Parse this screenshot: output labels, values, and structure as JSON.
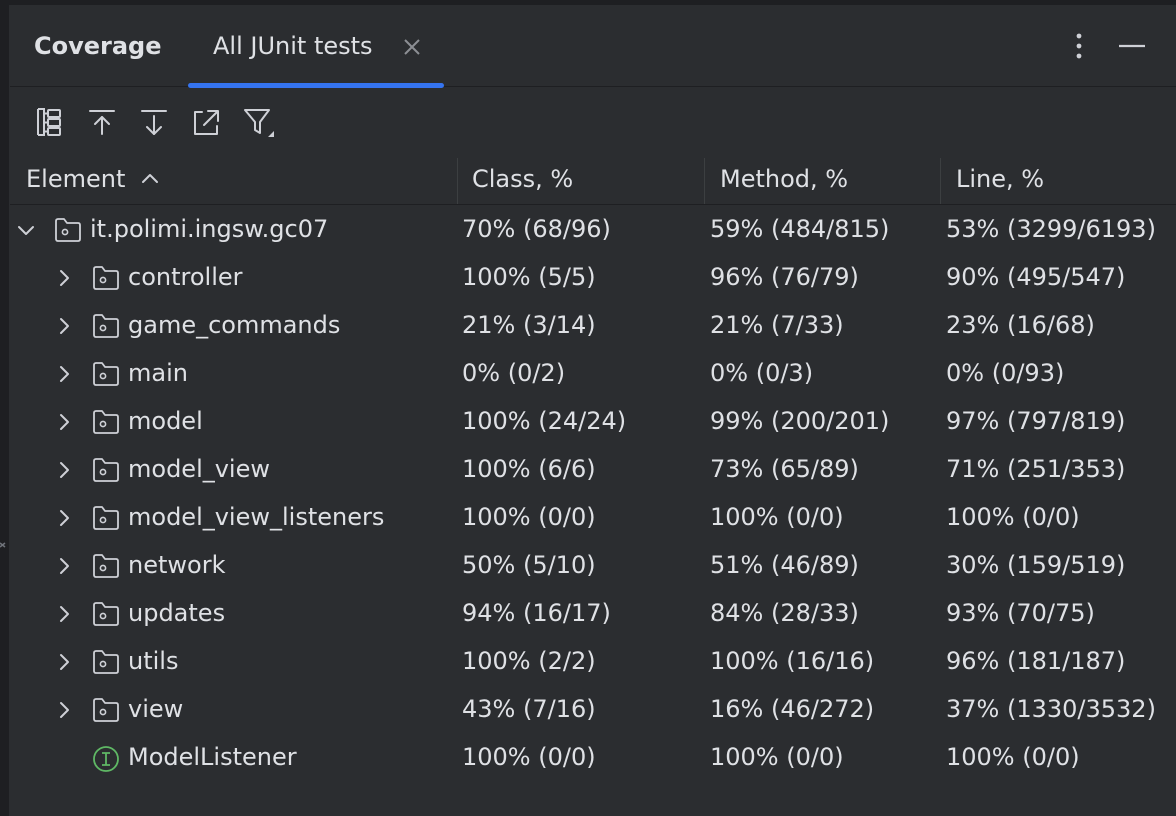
{
  "panel": {
    "title": "Coverage",
    "tab_label": "All JUnit tests"
  },
  "toolbar": {
    "buttons": [
      {
        "icon": "flatten-packages-icon"
      },
      {
        "icon": "navigate-up-icon"
      },
      {
        "icon": "navigate-down-icon"
      },
      {
        "icon": "open-source-icon"
      },
      {
        "icon": "filter-icon"
      }
    ]
  },
  "columns": {
    "element": "Element",
    "class": "Class, %",
    "method": "Method, %",
    "line": "Line, %"
  },
  "rows": [
    {
      "name": "it.polimi.ingsw.gc07",
      "kind": "package",
      "level": 0,
      "expanded": true,
      "class": "70% (68/96)",
      "method": "59% (484/815)",
      "line": "53% (3299/6193)"
    },
    {
      "name": "controller",
      "kind": "package",
      "level": 1,
      "expanded": false,
      "class": "100% (5/5)",
      "method": "96% (76/79)",
      "line": "90% (495/547)"
    },
    {
      "name": "game_commands",
      "kind": "package",
      "level": 1,
      "expanded": false,
      "class": "21% (3/14)",
      "method": "21% (7/33)",
      "line": "23% (16/68)"
    },
    {
      "name": "main",
      "kind": "package",
      "level": 1,
      "expanded": false,
      "class": "0% (0/2)",
      "method": "0% (0/3)",
      "line": "0% (0/93)"
    },
    {
      "name": "model",
      "kind": "package",
      "level": 1,
      "expanded": false,
      "class": "100% (24/24)",
      "method": "99% (200/201)",
      "line": "97% (797/819)"
    },
    {
      "name": "model_view",
      "kind": "package",
      "level": 1,
      "expanded": false,
      "class": "100% (6/6)",
      "method": "73% (65/89)",
      "line": "71% (251/353)"
    },
    {
      "name": "model_view_listeners",
      "kind": "package",
      "level": 1,
      "expanded": false,
      "class": "100% (0/0)",
      "method": "100% (0/0)",
      "line": "100% (0/0)"
    },
    {
      "name": "network",
      "kind": "package",
      "level": 1,
      "expanded": false,
      "class": "50% (5/10)",
      "method": "51% (46/89)",
      "line": "30% (159/519)"
    },
    {
      "name": "updates",
      "kind": "package",
      "level": 1,
      "expanded": false,
      "class": "94% (16/17)",
      "method": "84% (28/33)",
      "line": "93% (70/75)"
    },
    {
      "name": "utils",
      "kind": "package",
      "level": 1,
      "expanded": false,
      "class": "100% (2/2)",
      "method": "100% (16/16)",
      "line": "96% (181/187)"
    },
    {
      "name": "view",
      "kind": "package",
      "level": 1,
      "expanded": false,
      "class": "43% (7/16)",
      "method": "16% (46/272)",
      "line": "37% (1330/3532)"
    },
    {
      "name": "ModelListener",
      "kind": "interface",
      "level": 1,
      "expanded": null,
      "class": "100% (0/0)",
      "method": "100% (0/0)",
      "line": "100% (0/0)"
    }
  ],
  "colors": {
    "background": "#2b2d30",
    "text": "#dfe1e5",
    "accent": "#3574f0",
    "icon": "#ced0d6",
    "interface_icon": "#5fb865"
  }
}
